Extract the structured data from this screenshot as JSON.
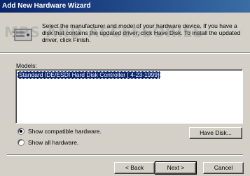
{
  "window": {
    "title": "Add New Hardware Wizard"
  },
  "watermark": {
    "text": "MPS AND ACCESSORIES"
  },
  "instructions": "Select the manufacturer and model of your hardware device. If you have a disk that contains the updated driver, click Have Disk. To install the updated driver, click Finish.",
  "models": {
    "label": "Models:",
    "items": [
      "Standard IDE/ESDI Hard Disk Controller [ 4-23-1999]"
    ],
    "selected_index": 0
  },
  "options": {
    "show_compatible": "Show compatible hardware.",
    "show_all": "Show all hardware.",
    "selected": "show_compatible"
  },
  "buttons": {
    "have_disk": "Have Disk...",
    "back": "< Back",
    "next": "Next >",
    "cancel": "Cancel"
  },
  "colors": {
    "titlebar_start": "#0a246a",
    "titlebar_end": "#3a6ea5",
    "face": "#d4d0c8",
    "selection": "#0a246a"
  },
  "icons": {
    "header": "hardware-device-icon"
  }
}
